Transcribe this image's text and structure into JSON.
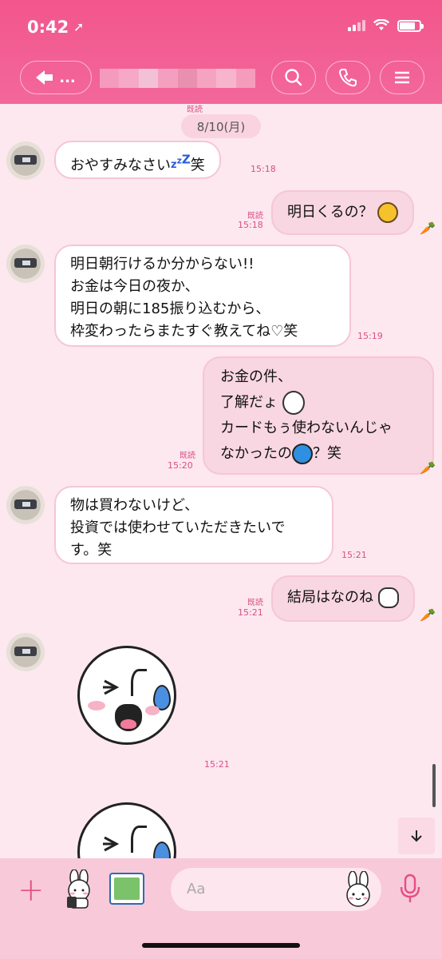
{
  "status_bar": {
    "time": "0:42"
  },
  "header": {
    "back_label": "..."
  },
  "date_label": "8/10(月)",
  "read_label": "既読",
  "messages": [
    {
      "side": "in",
      "lines": [
        "おやすみなさい",
        "笑"
      ],
      "time": "15:18"
    },
    {
      "side": "out",
      "lines": [
        "明日くるの？"
      ],
      "time": "15:18"
    },
    {
      "side": "in",
      "lines": [
        "明日朝行けるか分からない!!",
        "お金は今日の夜か、",
        "明日の朝に185振り込むから、",
        "枠変わったらまたすぐ教えてね♡笑"
      ],
      "time": "15:19"
    },
    {
      "side": "out",
      "lines": [
        "お金の件、",
        "了解だょ",
        "カードもぅ使わないんじゃ",
        "なかったの",
        "？笑"
      ],
      "time": "15:20"
    },
    {
      "side": "in",
      "lines": [
        "物は買わないけど、",
        "投資では使わせていただきたいで",
        "す。笑"
      ],
      "time": "15:21"
    },
    {
      "side": "out",
      "lines": [
        "結局はなのね"
      ],
      "time": "15:21"
    },
    {
      "side": "in",
      "type": "sticker",
      "time": "15:21"
    }
  ],
  "composer": {
    "placeholder": "Aa"
  }
}
